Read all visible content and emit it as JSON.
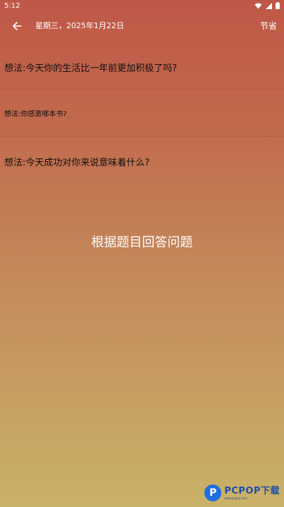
{
  "status_bar": {
    "time": "5:12",
    "icons": [
      "wifi-icon",
      "signal-icon",
      "battery-icon"
    ]
  },
  "app_bar": {
    "back_icon": "arrow-left-icon",
    "date_title": "星期三，2025年1月22日",
    "holiday_label": "节省"
  },
  "prompts": [
    {
      "text": "想法:今天你的生活比一年前更加积极了吗?"
    },
    {
      "text": "想法:你感激哪本书?"
    },
    {
      "text": "想法:今天成功对你来说意味着什么?"
    }
  ],
  "center_hint": "根据题目回答问题",
  "watermark": {
    "logo_letter": "P",
    "main": "PCPOP下载",
    "sub": "www.pcpop.com"
  },
  "colors": {
    "background_top": "#bf5747",
    "background_bottom": "#c9b267",
    "foreground_light": "#ffffff",
    "watermark_blue": "#1f4fa8"
  }
}
